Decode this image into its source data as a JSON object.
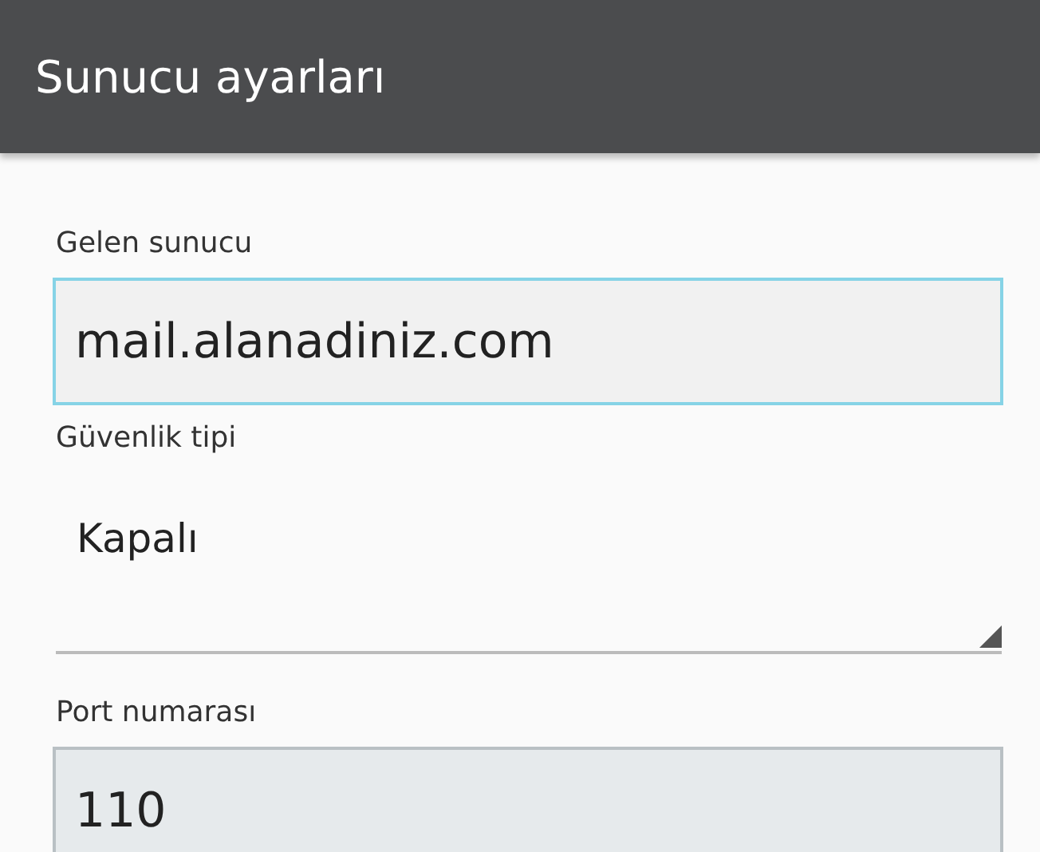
{
  "header": {
    "title": "Sunucu ayarları"
  },
  "fields": [
    {
      "kind": "text",
      "label": "Gelen sunucu",
      "value": "mail.alanadiniz.com",
      "focused": true
    },
    {
      "kind": "spinner",
      "label": "Güvenlik tipi",
      "value": "Kapalı"
    },
    {
      "kind": "text",
      "label": "Port numarası",
      "value": "110",
      "focused": false
    }
  ]
}
